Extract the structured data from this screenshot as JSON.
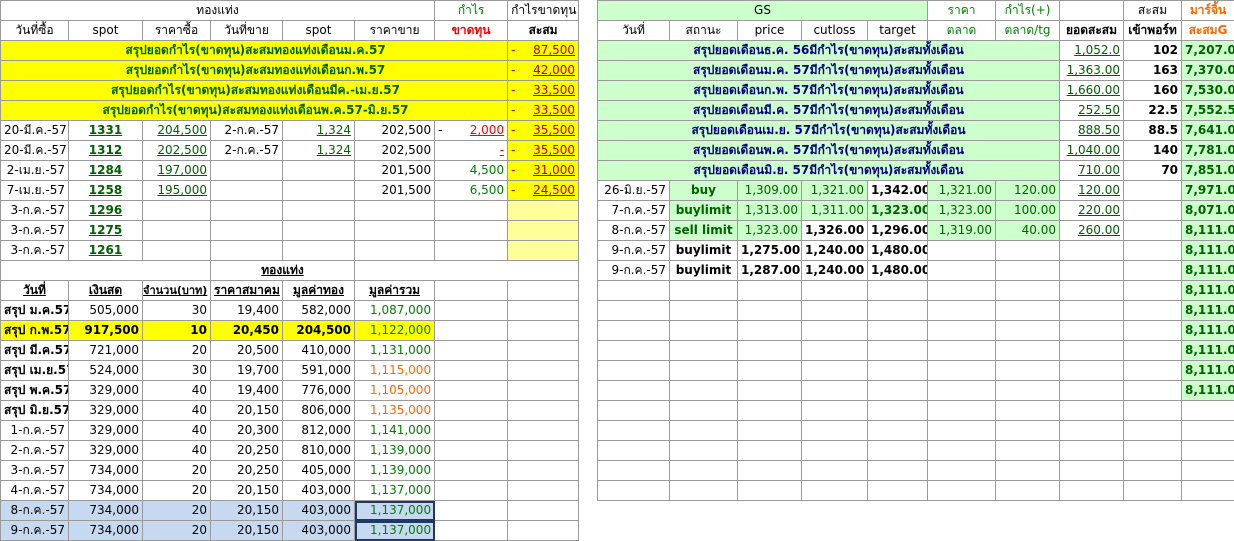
{
  "left": {
    "h1": {
      "gold": "ทองแท่ง",
      "profit": "กำไร",
      "profit_loss": "กำไรขาดทุน"
    },
    "h2": [
      "วันที่ซื้อ",
      "spot",
      "ราคาซื้อ",
      "วันที่ขาย",
      "spot",
      "ราคาขาย",
      "ขาดทุน",
      "สะสม"
    ],
    "summaries": [
      {
        "label": "สรุปยอดกำไร(ขาดทุน)สะสมทองแท่งเดือนม.ค.57",
        "dash": "-",
        "value": "87,500"
      },
      {
        "label": "สรุปยอดกำไร(ขาดทุน)สะสมทองแท่งเดือนก.พ.57",
        "dash": "-",
        "value": "42,000"
      },
      {
        "label": "สรุปยอดกำไร(ขาดทุน)สะสมทองแท่งเดือนมีค.-เม.ย.57",
        "dash": "-",
        "value": "33,500"
      },
      {
        "label": "สรุปยอดกำไร(ขาดทุน)สะสมทองแท่งเดือนพ.ค.57-มิ.ย.57",
        "dash": "-",
        "value": "33,500"
      }
    ],
    "trades": [
      {
        "buy_date": "20-มี.ค.-57",
        "spot": "1331",
        "buy_price": "204,500",
        "sell_date": "2-ก.ค.-57",
        "sell_spot": "1,324",
        "sell_price": "202,500",
        "pl_dash": "-",
        "pl": "2,000",
        "acc_dash": "-",
        "acc": "35,500"
      },
      {
        "buy_date": "20-มี.ค.-57",
        "spot": "1312",
        "buy_price": "202,500",
        "sell_date": "2-ก.ค.-57",
        "sell_spot": "1,324",
        "sell_price": "202,500",
        "pl_dash": "",
        "pl": "-",
        "acc_dash": "-",
        "acc": "35,500"
      },
      {
        "buy_date": "2-เม.ย.-57",
        "spot": "1284",
        "buy_price": "197,000",
        "sell_date": "",
        "sell_spot": "",
        "sell_price": "201,500",
        "pl_dash": "",
        "pl": "4,500",
        "acc_dash": "-",
        "acc": "31,000"
      },
      {
        "buy_date": "7-เม.ย.-57",
        "spot": "1258",
        "buy_price": "195,000",
        "sell_date": "",
        "sell_spot": "",
        "sell_price": "201,500",
        "pl_dash": "",
        "pl": "6,500",
        "acc_dash": "-",
        "acc": "24,500"
      },
      {
        "buy_date": "3-ก.ค.-57",
        "spot": "1296",
        "buy_price": "",
        "sell_date": "",
        "sell_spot": "",
        "sell_price": "",
        "pl_dash": "",
        "pl": "",
        "acc_dash": "",
        "acc": ""
      },
      {
        "buy_date": "3-ก.ค.-57",
        "spot": "1275",
        "buy_price": "",
        "sell_date": "",
        "sell_spot": "",
        "sell_price": "",
        "pl_dash": "",
        "pl": "",
        "acc_dash": "",
        "acc": ""
      },
      {
        "buy_date": "3-ก.ค.-57",
        "spot": "1261",
        "buy_price": "",
        "sell_date": "",
        "sell_spot": "",
        "sell_price": "",
        "pl_dash": "",
        "pl": "",
        "acc_dash": "",
        "acc": ""
      }
    ],
    "gold_title": "ทองแท่ง",
    "h3": [
      "วันที่",
      "เงินสด",
      "จำนวน(บาท)",
      "ราคาสมาคม",
      "มูลค่าทอง",
      "มูลค่ารวม"
    ],
    "portfolio": [
      {
        "date": "สรุป ม.ค.57",
        "cash": "505,000",
        "qty": "30",
        "price": "19,400",
        "gold": "582,000",
        "total": "1,087,000",
        "hl": "",
        "tc": "grn"
      },
      {
        "date": "สรุป ก.พ.57",
        "cash": "917,500",
        "qty": "10",
        "price": "20,450",
        "gold": "204,500",
        "total": "1,122,000",
        "hl": "yel",
        "tc": "grn"
      },
      {
        "date": "สรุป มี.ค.57",
        "cash": "721,000",
        "qty": "20",
        "price": "20,500",
        "gold": "410,000",
        "total": "1,131,000",
        "hl": "",
        "tc": "grn"
      },
      {
        "date": "สรุป เม.ย.57",
        "cash": "524,000",
        "qty": "30",
        "price": "19,700",
        "gold": "591,000",
        "total": "1,115,000",
        "hl": "",
        "tc": "org"
      },
      {
        "date": "สรุป พ.ค.57",
        "cash": "329,000",
        "qty": "40",
        "price": "19,400",
        "gold": "776,000",
        "total": "1,105,000",
        "hl": "",
        "tc": "org"
      },
      {
        "date": "สรุป มิ.ย.57",
        "cash": "329,000",
        "qty": "40",
        "price": "20,150",
        "gold": "806,000",
        "total": "1,135,000",
        "hl": "",
        "tc": "org"
      },
      {
        "date": "1-ก.ค.-57",
        "cash": "329,000",
        "qty": "40",
        "price": "20,300",
        "gold": "812,000",
        "total": "1,141,000",
        "hl": "",
        "tc": "grn"
      },
      {
        "date": "2-ก.ค.-57",
        "cash": "329,000",
        "qty": "40",
        "price": "20,250",
        "gold": "810,000",
        "total": "1,139,000",
        "hl": "",
        "tc": "grn"
      },
      {
        "date": "3-ก.ค.-57",
        "cash": "734,000",
        "qty": "20",
        "price": "20,250",
        "gold": "405,000",
        "total": "1,139,000",
        "hl": "",
        "tc": "grn"
      },
      {
        "date": "4-ก.ค.-57",
        "cash": "734,000",
        "qty": "20",
        "price": "20,150",
        "gold": "403,000",
        "total": "1,137,000",
        "hl": "",
        "tc": "grn"
      },
      {
        "date": "8-ก.ค.-57",
        "cash": "734,000",
        "qty": "20",
        "price": "20,150",
        "gold": "403,000",
        "total": "1,137,000",
        "hl": "blu",
        "tc": "grn"
      },
      {
        "date": "9-ก.ค.-57",
        "cash": "734,000",
        "qty": "20",
        "price": "20,150",
        "gold": "403,000",
        "total": "1,137,000",
        "hl": "blu",
        "tc": "grn"
      }
    ]
  },
  "right": {
    "h1": {
      "gs": "GS",
      "price": "ราคา",
      "profit": "กำไร(+)",
      "acc": "สะสม",
      "margin": "มาร์จิ้น"
    },
    "h2": [
      "วันที่",
      "สถานะ",
      "price",
      "cutloss",
      "target",
      "ตลาด",
      "ตลาด/tg",
      "ยอดสะสม",
      "เข้าพอร์ท",
      "สะสมG"
    ],
    "summaries": [
      {
        "label": "สรุปยอดเดือนธ.ค. 56มีกำไร(ขาดทุน)สะสมทั้งเดือน",
        "acc": "1,052.0",
        "port": "102",
        "margin": "7,207.0"
      },
      {
        "label": "สรุปยอดเดือนม.ค. 57มีกำไร(ขาดทุน)สะสมทั้งเดือน",
        "acc": "1,363.00",
        "port": "163",
        "margin": "7,370.0"
      },
      {
        "label": "สรุปยอดเดือนก.พ. 57มีกำไร(ขาดทุน)สะสมทั้งเดือน",
        "acc": "1,660.00",
        "port": "160",
        "margin": "7,530.0"
      },
      {
        "label": "สรุปยอดเดือนมี.ค. 57มีกำไร(ขาดทุน)สะสมทั้งเดือน",
        "acc": "252.50",
        "port": "22.5",
        "margin": "7,552.5"
      },
      {
        "label": "สรุปยอดเดือนเม.ย. 57มีกำไร(ขาดทุน)สะสมทั้งเดือน",
        "acc": "888.50",
        "port": "88.5",
        "margin": "7,641.0"
      },
      {
        "label": "สรุปยอดเดือนพ.ค. 57มีกำไร(ขาดทุน)สะสมทั้งเดือน",
        "acc": "1,040.00",
        "port": "140",
        "margin": "7,781.0"
      },
      {
        "label": "สรุปยอดเดือนมิ.ย. 57มีกำไร(ขาดทุน)สะสมทั้งเดือน",
        "acc": "710.00",
        "port": "70",
        "margin": "7,851.0"
      }
    ],
    "orders": [
      {
        "date": "26-มิ.ย.-57",
        "status": "buy",
        "price": "1,309.00",
        "cutloss": "1,321.00",
        "target": "1,342.00",
        "market": "1,321.00",
        "profit": "120.00",
        "acc": "120.00",
        "margin": "7,971.0",
        "active": true
      },
      {
        "date": "7-ก.ค.-57",
        "status": "buylimit",
        "price": "1,313.00",
        "cutloss": "1,311.00",
        "target": "1,323.00",
        "market": "1,323.00",
        "profit": "100.00",
        "acc": "220.00",
        "margin": "8,071.0",
        "active": true
      },
      {
        "date": "8-ก.ค.-57",
        "status": "sell limit",
        "price": "1,323.00",
        "cutloss": "1,326.00",
        "target": "1,296.00",
        "market": "1,319.00",
        "profit": "40.00",
        "acc": "260.00",
        "margin": "8,111.0",
        "active": true
      },
      {
        "date": "9-ก.ค.-57",
        "status": "buylimit",
        "price": "1,275.00",
        "cutloss": "1,240.00",
        "target": "1,480.00",
        "market": "",
        "profit": "",
        "acc": "",
        "margin": "8,111.0",
        "active": false
      },
      {
        "date": "9-ก.ค.-57",
        "status": "buylimit",
        "price": "1,287.00",
        "cutloss": "1,240.00",
        "target": "1,480.00",
        "market": "",
        "profit": "",
        "acc": "",
        "margin": "8,111.0",
        "active": false
      }
    ],
    "margin_tail": [
      "8,111.0",
      "8,111.0",
      "8,111.0",
      "8,111.0",
      "8,111.0",
      "8,111.0"
    ]
  }
}
